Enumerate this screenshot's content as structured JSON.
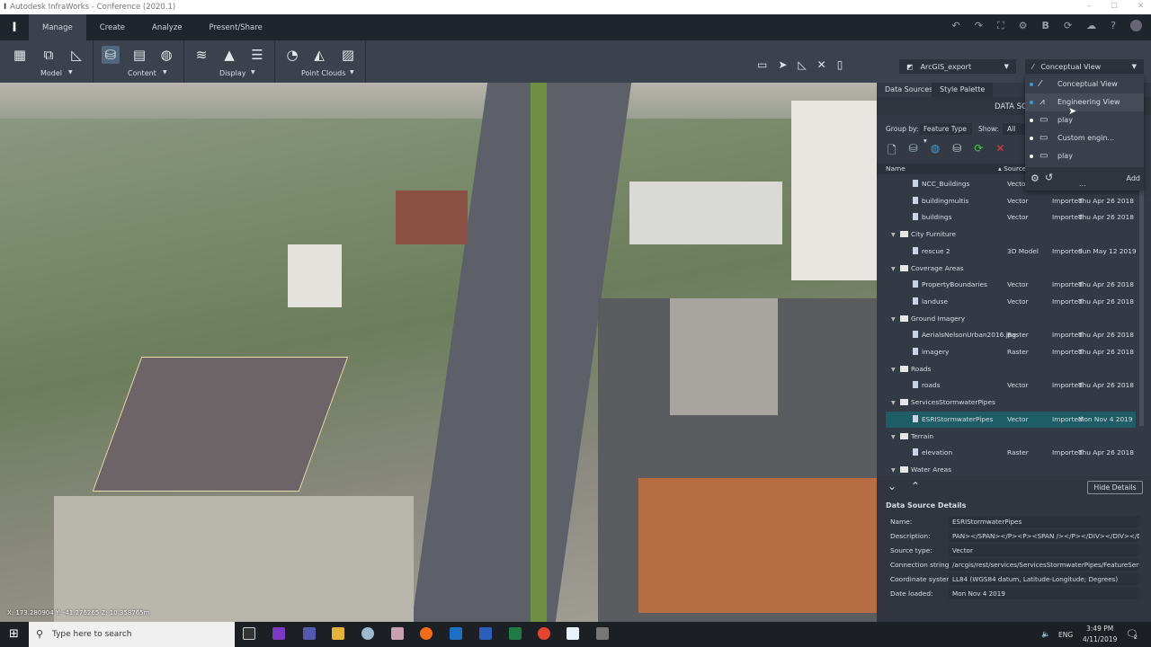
{
  "window": {
    "title": "Autodesk InfraWorks - Conference (2020.1)"
  },
  "ribbon": {
    "tabs": [
      {
        "label": "Manage",
        "active": true
      },
      {
        "label": "Create"
      },
      {
        "label": "Analyze"
      },
      {
        "label": "Present/Share"
      }
    ],
    "groups": [
      {
        "label": "Model",
        "icons": [
          "building-icon",
          "layers-icon",
          "drawing-icon"
        ]
      },
      {
        "label": "Content",
        "icons": [
          "database-import-icon",
          "calculator-icon",
          "globe-icon"
        ]
      },
      {
        "label": "Display",
        "icons": [
          "stack-icon",
          "terrain-icon",
          "list-icon"
        ]
      },
      {
        "label": "Point Clouds",
        "icons": [
          "pointcloud-icon",
          "pointcloud-terrain-icon",
          "pointcloud-hatch-icon"
        ]
      }
    ],
    "proposal_dropdown": "ArcGIS_export",
    "view_dropdown": "Conceptual View"
  },
  "view_menu": {
    "items": [
      {
        "label": "Conceptual View",
        "icon": "conceptual-icon",
        "dot": "#3a9ad9"
      },
      {
        "label": "Engineering View",
        "icon": "compass-icon",
        "dot": "#3a9ad9"
      },
      {
        "label": "play",
        "icon": "monitor-icon",
        "dot": "#ffffff"
      },
      {
        "label": "Custom engin...",
        "icon": "monitor-icon",
        "dot": "#ffffff"
      },
      {
        "label": "play",
        "icon": "monitor-icon",
        "dot": "#ffffff"
      }
    ],
    "add_label": "Add",
    "more": "..."
  },
  "panel": {
    "tabs": [
      "Data Sources",
      "Style Palette"
    ],
    "header": "DATA SOU",
    "group_by_label": "Group by:",
    "group_by_value": "Feature Type",
    "show_label": "Show:",
    "show_value": "All",
    "columns": {
      "name": "Name",
      "source": "Source"
    },
    "rows": [
      {
        "type": "item",
        "name": "NCC_Buildings",
        "source": "Vecto",
        "status": "",
        "date": ""
      },
      {
        "type": "item",
        "name": "buildingmultis",
        "source": "Vector",
        "status": "Imported",
        "date": "Thu Apr 26 2018"
      },
      {
        "type": "item",
        "name": "buildings",
        "source": "Vector",
        "status": "Imported",
        "date": "Thu Apr 26 2018"
      },
      {
        "type": "folder",
        "name": "City Furniture"
      },
      {
        "type": "item",
        "name": "rescue 2",
        "source": "3D Model",
        "status": "Imported",
        "date": "Sun May 12 2019"
      },
      {
        "type": "folder",
        "name": "Coverage Areas"
      },
      {
        "type": "item",
        "name": "PropertyBoundaries",
        "source": "Vector",
        "status": "Imported",
        "date": "Thu Apr 26 2018"
      },
      {
        "type": "item",
        "name": "landuse",
        "source": "Vector",
        "status": "Imported",
        "date": "Thu Apr 26 2018"
      },
      {
        "type": "folder",
        "name": "Ground Imagery"
      },
      {
        "type": "item",
        "name": "AerialsNelsonUrban2016.jpg",
        "source": "Raster",
        "status": "Imported",
        "date": "Thu Apr 26 2018"
      },
      {
        "type": "item",
        "name": "imagery",
        "source": "Raster",
        "status": "Imported",
        "date": "Thu Apr 26 2018"
      },
      {
        "type": "folder",
        "name": "Roads"
      },
      {
        "type": "item",
        "name": "roads",
        "source": "Vector",
        "status": "Imported",
        "date": "Thu Apr 26 2018"
      },
      {
        "type": "folder",
        "name": "ServicesStormwaterPipes"
      },
      {
        "type": "item",
        "name": "ESRIStormwaterPipes",
        "source": "Vector",
        "status": "Imported",
        "date": "Mon Nov 4 2019",
        "selected": true
      },
      {
        "type": "folder",
        "name": "Terrain"
      },
      {
        "type": "item",
        "name": "elevation",
        "source": "Raster",
        "status": "Imported",
        "date": "Thu Apr 26 2018"
      },
      {
        "type": "folder",
        "name": "Water Areas"
      }
    ],
    "hide_details": "Hide Details",
    "details": {
      "title": "Data Source Details",
      "fields": [
        {
          "label": "Name:",
          "value": "ESRIStormwaterPipes"
        },
        {
          "label": "Description:",
          "value": "PAN></SPAN></P><P><SPAN /></P></DIV></DIV></DIV>"
        },
        {
          "label": "Source type:",
          "value": "Vector"
        },
        {
          "label": "Connection string:",
          "value": "/arcgis/rest/services/ServicesStormwaterPipes/FeatureServer/0"
        },
        {
          "label": "Coordinate system:",
          "value": "LL84 (WGS84 datum, Latitude-Longitude; Degrees)"
        },
        {
          "label": "Date loaded:",
          "value": "Mon Nov 4 2019"
        }
      ]
    }
  },
  "viewport": {
    "coords": "X: 173.280904 Y: -41.276265 Z: 10.358765m"
  },
  "taskbar": {
    "search_placeholder": "Type here to search",
    "time": "3:49 PM",
    "date": "4/11/2019",
    "lang": "ENG",
    "notifications": "2"
  }
}
